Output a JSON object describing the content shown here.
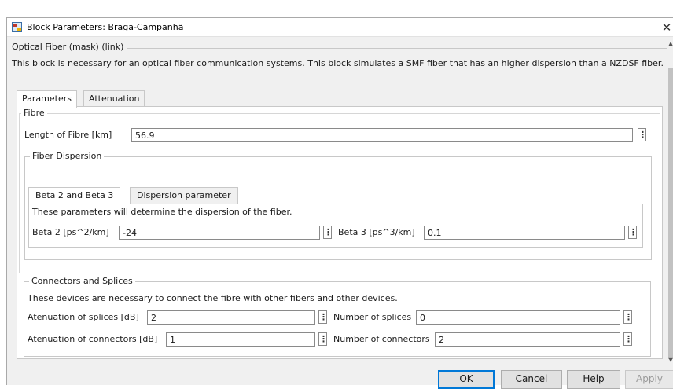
{
  "window": {
    "title": "Block Parameters: Braga-Campanhã",
    "close_glyph": "✕"
  },
  "block": {
    "header": "Optical Fiber (mask) (link)",
    "description": "This block is necessary for an  optical fiber communication systems. This block simulates a SMF fiber that has an higher dispersion than a NZDSF fiber."
  },
  "tabs": [
    {
      "label": "Parameters",
      "active": true
    },
    {
      "label": "Attenuation",
      "active": false
    }
  ],
  "fibre": {
    "group_label": "Fibre",
    "length_label": "Length of Fibre [km]",
    "length_value": "56.9",
    "dispersion": {
      "group_label": "Fiber Dispersion",
      "tabs": [
        {
          "label": "Beta 2 and Beta 3",
          "active": true
        },
        {
          "label": "Dispersion parameter",
          "active": false
        }
      ],
      "note": "These parameters will determine the dispersion of the fiber.",
      "beta2_label": "Beta 2 [ps^2/km]",
      "beta2_value": "-24",
      "beta3_label": "Beta 3 [ps^3/km]",
      "beta3_value": "0.1"
    }
  },
  "connectors": {
    "group_label": "Connectors and Splices",
    "note": "These devices are necessary to connect the fibre with other fibers and other devices.",
    "splice_att_label": "Atenuation of splices [dB]",
    "splice_att_value": "2",
    "num_splices_label": "Number of splices",
    "num_splices_value": "0",
    "conn_att_label": "Atenuation of connectors [dB]",
    "conn_att_value": "1",
    "num_connectors_label": "Number of connectors",
    "num_connectors_value": "2"
  },
  "buttons": {
    "ok": "OK",
    "cancel": "Cancel",
    "help": "Help",
    "apply": "Apply"
  },
  "colors": {
    "default_button_border": "#0078d7",
    "dialog_bg": "#f0f0f0"
  }
}
